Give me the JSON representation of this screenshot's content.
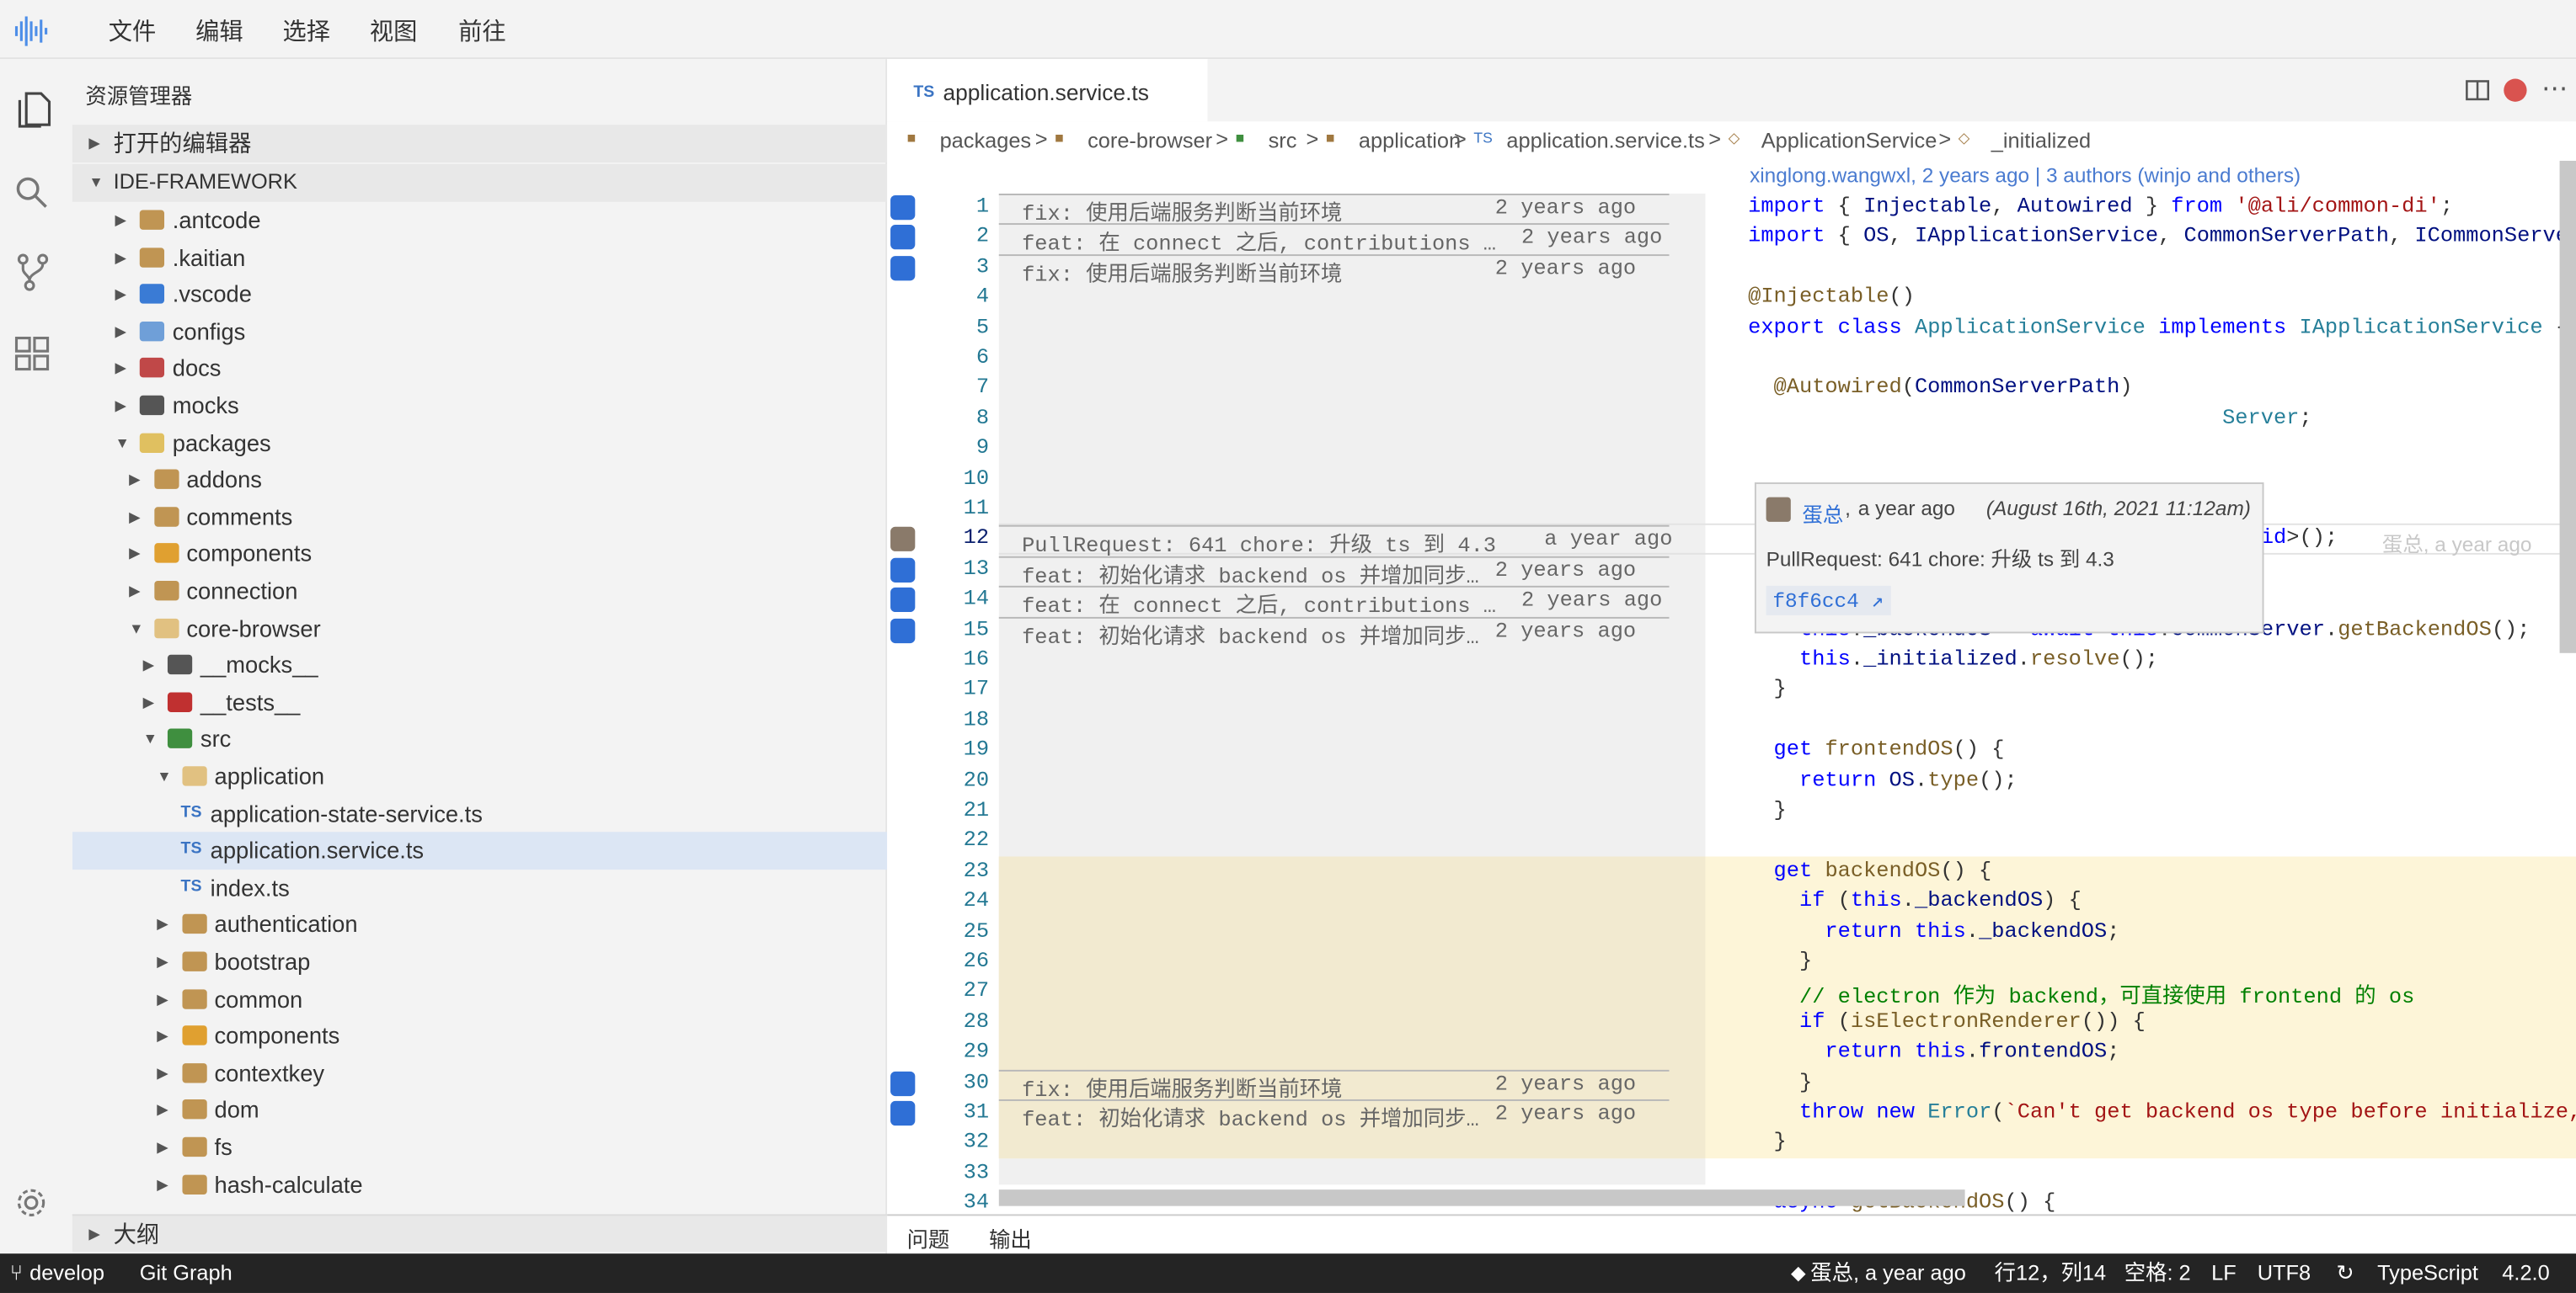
{
  "menu": [
    "文件",
    "编辑",
    "选择",
    "视图",
    "前往"
  ],
  "sidebar": {
    "title": "资源管理器",
    "open_editors": "打开的编辑器",
    "root": "IDE-FRAMEWORK",
    "items": [
      {
        "label": ".antcode",
        "depth": 0,
        "open": false,
        "icon": "folder-icon"
      },
      {
        "label": ".kaitian",
        "depth": 0,
        "open": false,
        "icon": "folder-icon"
      },
      {
        "label": ".vscode",
        "depth": 0,
        "open": false,
        "icon": "folder-vscode-icon"
      },
      {
        "label": "configs",
        "depth": 0,
        "open": false,
        "icon": "folder-config-icon"
      },
      {
        "label": "docs",
        "depth": 0,
        "open": false,
        "icon": "folder-docs-icon"
      },
      {
        "label": "mocks",
        "depth": 0,
        "open": false,
        "icon": "folder-mocks-icon"
      },
      {
        "label": "packages",
        "depth": 0,
        "open": true,
        "icon": "folder-packages-icon"
      },
      {
        "label": "addons",
        "depth": 1,
        "open": false,
        "icon": "folder-icon"
      },
      {
        "label": "comments",
        "depth": 1,
        "open": false,
        "icon": "folder-icon"
      },
      {
        "label": "components",
        "depth": 1,
        "open": false,
        "icon": "folder-components-icon"
      },
      {
        "label": "connection",
        "depth": 1,
        "open": false,
        "icon": "folder-icon"
      },
      {
        "label": "core-browser",
        "depth": 1,
        "open": true,
        "icon": "folder-open-icon"
      },
      {
        "label": "__mocks__",
        "depth": 2,
        "open": false,
        "icon": "folder-mocks-icon"
      },
      {
        "label": "__tests__",
        "depth": 2,
        "open": false,
        "icon": "folder-tests-icon"
      },
      {
        "label": "src",
        "depth": 2,
        "open": true,
        "icon": "folder-src-icon"
      },
      {
        "label": "application",
        "depth": 3,
        "open": true,
        "icon": "folder-open-icon"
      },
      {
        "label": "application-state-service.ts",
        "depth": 4,
        "file": true,
        "icon": "typescript-file-icon"
      },
      {
        "label": "application.service.ts",
        "depth": 4,
        "file": true,
        "selected": true,
        "icon": "typescript-file-icon"
      },
      {
        "label": "index.ts",
        "depth": 4,
        "file": true,
        "icon": "typescript-file-icon"
      },
      {
        "label": "authentication",
        "depth": 3,
        "open": false,
        "icon": "folder-icon"
      },
      {
        "label": "bootstrap",
        "depth": 3,
        "open": false,
        "icon": "folder-icon"
      },
      {
        "label": "common",
        "depth": 3,
        "open": false,
        "icon": "folder-icon"
      },
      {
        "label": "components",
        "depth": 3,
        "open": false,
        "icon": "folder-components-icon"
      },
      {
        "label": "contextkey",
        "depth": 3,
        "open": false,
        "icon": "folder-icon"
      },
      {
        "label": "dom",
        "depth": 3,
        "open": false,
        "icon": "folder-icon"
      },
      {
        "label": "fs",
        "depth": 3,
        "open": false,
        "icon": "folder-icon"
      },
      {
        "label": "hash-calculate",
        "depth": 3,
        "open": false,
        "icon": "folder-icon"
      }
    ],
    "outline": "大纲"
  },
  "editor": {
    "tab_label": "application.service.ts",
    "tab_icon": "TS",
    "breadcrumb": [
      "packages",
      "core-browser",
      "src",
      "application",
      "application.service.ts",
      "ApplicationService",
      "_initialized"
    ],
    "codelens": "xinglong.wangwxl, 2 years ago | 3 authors (winjo and others)",
    "line_numbers": [
      "1",
      "2",
      "3",
      "4",
      "5",
      "6",
      "7",
      "8",
      "9",
      "10",
      "11",
      "12",
      "13",
      "14",
      "15",
      "16",
      "17",
      "18",
      "19",
      "20",
      "21",
      "22",
      "23",
      "24",
      "25",
      "26",
      "27",
      "28",
      "29",
      "30",
      "31",
      "32",
      "33",
      "34"
    ],
    "blame": [
      {
        "line": 1,
        "msg": "fix: 使用后端服务判断当前环境",
        "age": "2 years ago"
      },
      {
        "line": 2,
        "msg": "feat: 在 connect 之后, contributions …",
        "age": "2 years ago"
      },
      {
        "line": 3,
        "msg": "fix: 使用后端服务判断当前环境",
        "age": "2 years ago"
      },
      {
        "line": 12,
        "msg": "PullRequest: 641 chore: 升级 ts 到 4.3",
        "age": "a year ago"
      },
      {
        "line": 13,
        "msg": "feat: 初始化请求 backend os 并增加同步…",
        "age": "2 years ago"
      },
      {
        "line": 14,
        "msg": "feat: 在 connect 之后, contributions …",
        "age": "2 years ago"
      },
      {
        "line": 15,
        "msg": "feat: 初始化请求 backend os 并增加同步…",
        "age": "2 years ago"
      },
      {
        "line": 30,
        "msg": "fix: 使用后端服务判断当前环境",
        "age": "2 years ago"
      },
      {
        "line": 31,
        "msg": "feat: 初始化请求 backend os 并增加同步…",
        "age": "2 years ago"
      }
    ],
    "inline_blame": "蛋总, a year ago",
    "hover": {
      "author": "蛋总",
      "age": "a year ago",
      "date": "(August 16th, 2021 11:12am)",
      "message": "PullRequest: 641 chore: 升级 ts 到 4.3",
      "commit": "f8f6cc4 ↗"
    }
  },
  "panel": {
    "tabs": [
      "问题",
      "输出"
    ]
  },
  "status": {
    "branch": "develop",
    "git_graph": "Git Graph",
    "blame": "蛋总, a year ago",
    "position": "行12，列14",
    "indent": "空格: 2",
    "eol": "LF",
    "encoding": "UTF8",
    "language": "TypeScript",
    "version": "4.2.0"
  },
  "colors": {
    "accent": "#3b74c3",
    "selection": "#dce6f4",
    "highlight": "#fdf5d8",
    "status_bar": "#242424"
  }
}
